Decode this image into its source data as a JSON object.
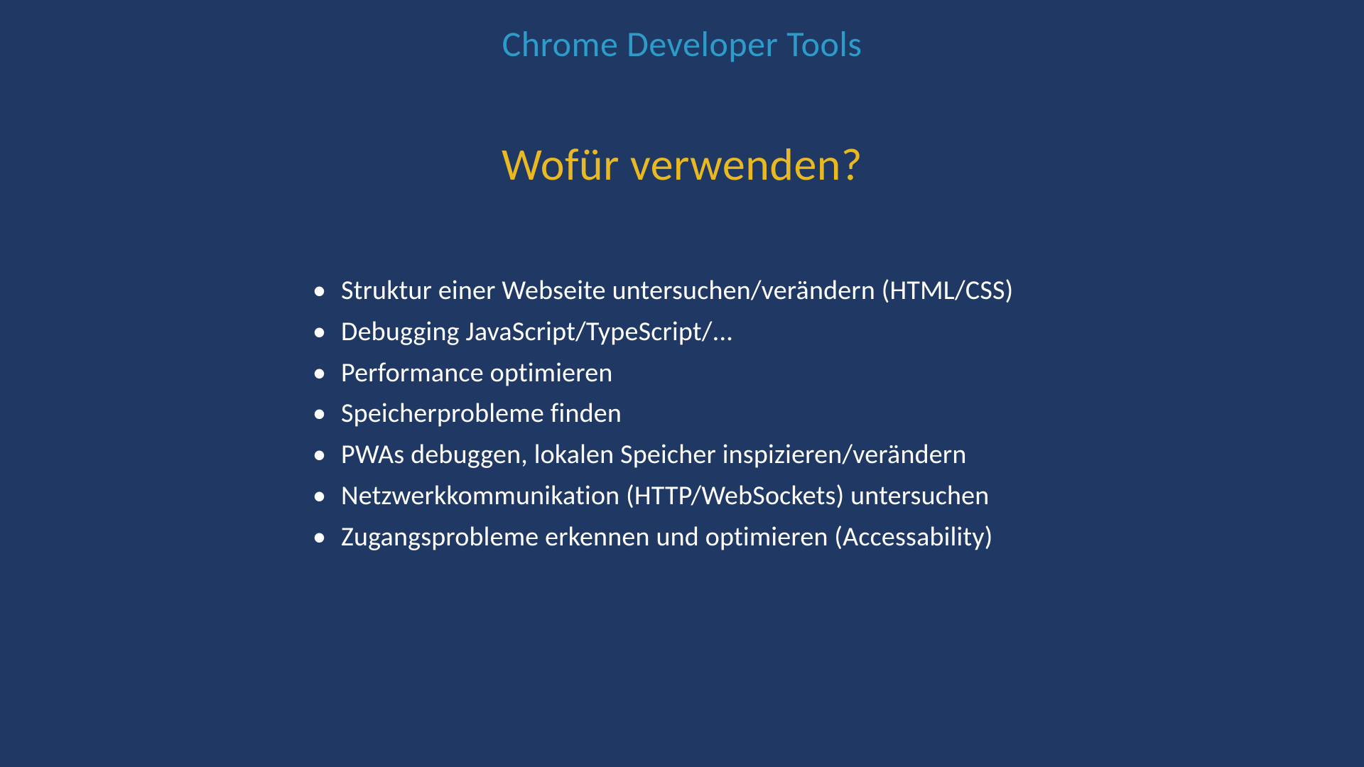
{
  "header": "Chrome Developer Tools",
  "title": "Wofür verwenden?",
  "bullets": [
    "Struktur einer Webseite untersuchen/verändern (HTML/CSS)",
    "Debugging JavaScript/TypeScript/...",
    "Performance optimieren",
    "Speicherprobleme finden",
    "PWAs debuggen, lokalen Speicher inspizieren/verändern",
    "Netzwerkkommunikation (HTTP/WebSockets) untersuchen",
    "Zugangsprobleme erkennen und optimieren (Accessability)"
  ]
}
